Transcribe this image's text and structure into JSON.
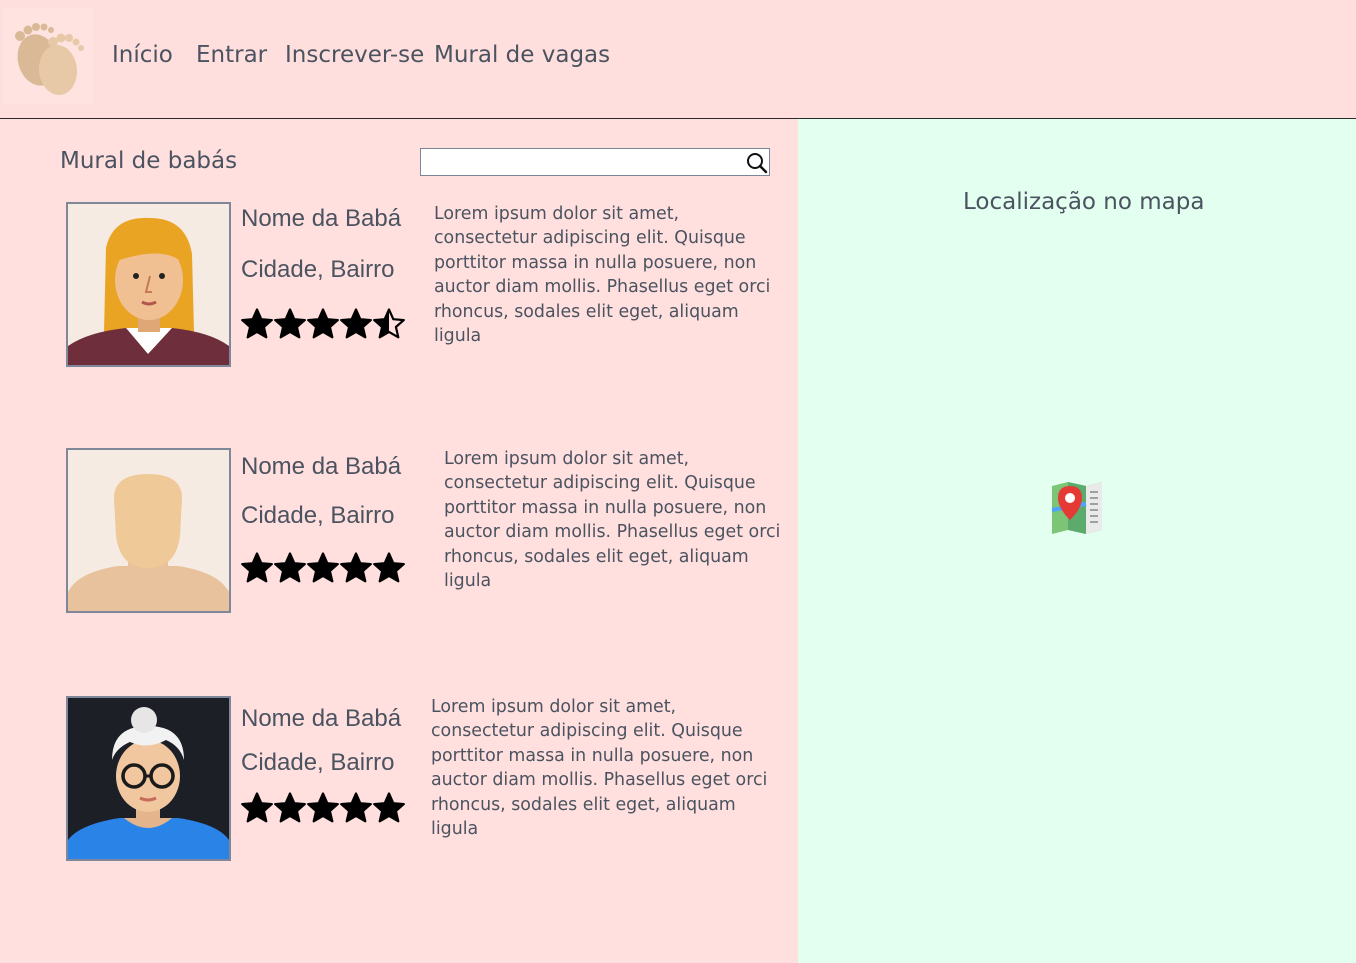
{
  "header": {
    "logo_icon": "baby-feet-icon",
    "nav": [
      {
        "label": "Início"
      },
      {
        "label": "Entrar"
      },
      {
        "label": "Inscrever-se"
      },
      {
        "label": "Mural de vagas"
      }
    ]
  },
  "board": {
    "title": "Mural de babás",
    "search": {
      "placeholder": "",
      "value": ""
    },
    "search_icon": "magnifier-icon",
    "nannies": [
      {
        "name": "Nome da Babá",
        "location": "Cidade, Bairro",
        "rating": 4.5,
        "avatar": "woman-orange-hair-avatar",
        "description": "Lorem ipsum dolor sit amet, consectetur adipiscing elit. Quisque porttitor massa in nulla posuere, non auctor diam mollis. Phasellus eget orci rhoncus, sodales elit eget, aliquam ligula"
      },
      {
        "name": "Nome da Babá",
        "location": "Cidade, Bairro",
        "rating": 5,
        "avatar": "blank-avatar",
        "description": "Lorem ipsum dolor sit amet, consectetur adipiscing elit. Quisque porttitor massa in nulla posuere, non auctor diam mollis. Phasellus eget orci rhoncus, sodales elit eget, aliquam ligula"
      },
      {
        "name": "Nome da Babá",
        "location": "Cidade, Bairro",
        "rating": 5,
        "avatar": "older-woman-glasses-avatar",
        "description": "Lorem ipsum dolor sit amet, consectetur adipiscing elit. Quisque porttitor massa in nulla posuere, non auctor diam mollis. Phasellus eget orci rhoncus, sodales elit eget, aliquam ligula"
      }
    ]
  },
  "map": {
    "title": "Localização no mapa",
    "icon": "map-pin-icon"
  },
  "colors": {
    "page_bg": "#ffe0de",
    "map_bg": "#e3fff0",
    "text": "#4b5360",
    "star": "#000000"
  }
}
